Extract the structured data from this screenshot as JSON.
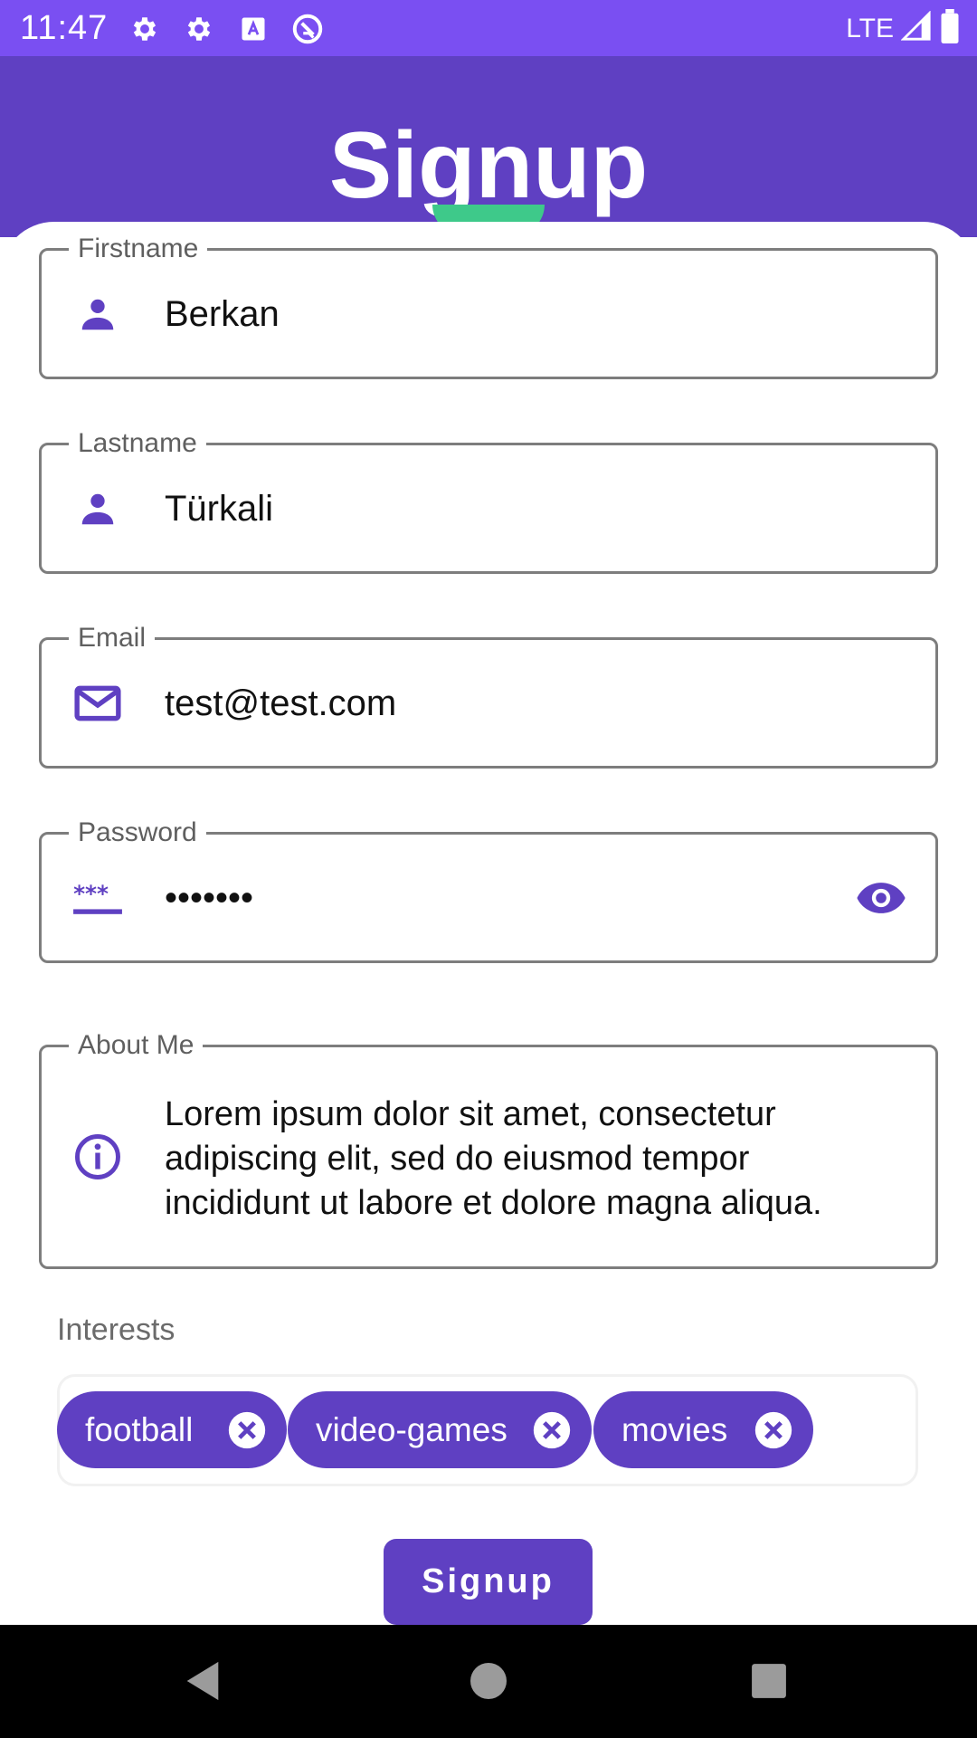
{
  "status_bar": {
    "time": "11:47",
    "network": "LTE",
    "icons": [
      "gear-icon",
      "gear-icon",
      "text-a-icon",
      "sync-icon",
      "signal-icon",
      "battery-icon"
    ]
  },
  "header": {
    "title": "Signup"
  },
  "form": {
    "firstname": {
      "label": "Firstname",
      "value": "Berkan",
      "icon": "person-icon"
    },
    "lastname": {
      "label": "Lastname",
      "value": "Türkali",
      "icon": "person-icon"
    },
    "email": {
      "label": "Email",
      "value": "test@test.com",
      "icon": "mail-icon"
    },
    "password": {
      "label": "Password",
      "value": "•••••••",
      "icon": "password-icon",
      "toggle_icon": "eye-icon"
    },
    "about": {
      "label": "About Me",
      "value": "Lorem ipsum dolor sit amet, consectetur adipiscing elit, sed do eiusmod tempor incididunt ut labore et dolore magna aliqua.",
      "icon": "info-icon"
    }
  },
  "interests": {
    "label": "Interests",
    "chips": [
      {
        "label": "football"
      },
      {
        "label": "video-games"
      },
      {
        "label": "movies"
      }
    ]
  },
  "actions": {
    "signup_label": "Signup"
  },
  "colors": {
    "status_bar": "#7a4ff2",
    "primary": "#5f40c2",
    "avatar_accent": "#3ec98a"
  }
}
